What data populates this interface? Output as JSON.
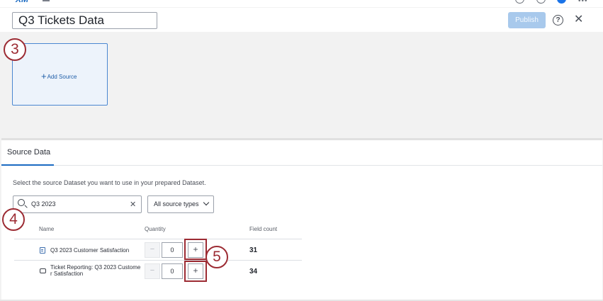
{
  "header": {
    "logo_text": "XM",
    "title": "Q3 Tickets Data",
    "publish_label": "Publish",
    "help_glyph": "?",
    "close_glyph": "✕"
  },
  "canvas": {
    "add_source_label": "Add Source"
  },
  "callouts": {
    "step3": "3",
    "step4": "4",
    "step5": "5"
  },
  "panel": {
    "tab_label": "Source Data",
    "instructions": "Select the source Dataset you want to use in your prepared Dataset.",
    "search": {
      "value": "Q3 2023",
      "clear_glyph": "✕"
    },
    "filter_label": "All source types",
    "columns": {
      "name": "Name",
      "quantity": "Quantity",
      "field_count": "Field count"
    },
    "rows": [
      {
        "icon": "survey-icon",
        "name": "Q3 2023 Customer Satisfaction",
        "quantity": "0",
        "field_count": "31"
      },
      {
        "icon": "ticket-icon",
        "name_line1": "Ticket Reporting: Q3 2023 Custome",
        "name_line2": "r Satisfaction",
        "quantity": "0",
        "field_count": "34"
      }
    ],
    "minus_glyph": "−",
    "plus_glyph": "+"
  },
  "colors": {
    "accent": "#1a6ac2",
    "callout": "#9c2b33",
    "publish_disabled": "#a8c9ec"
  }
}
